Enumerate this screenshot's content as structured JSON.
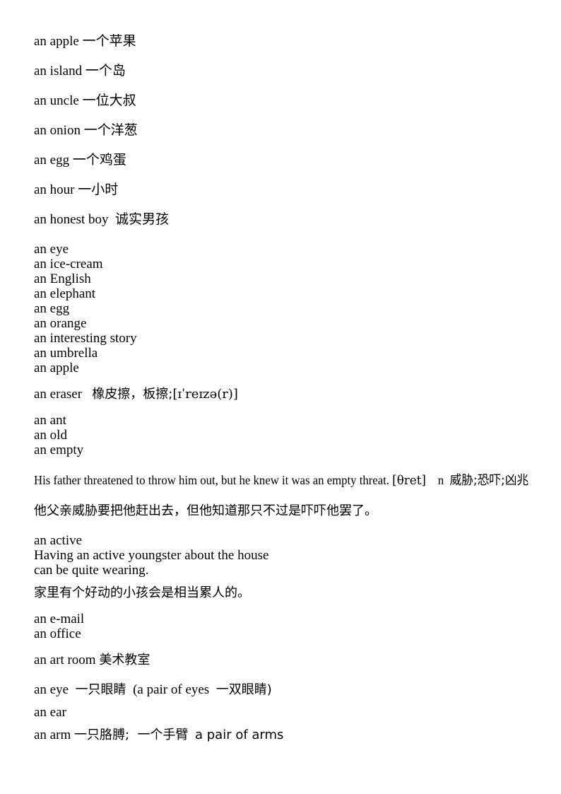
{
  "document": {
    "type": "vocabulary-worksheet",
    "language": "English-Chinese",
    "topic": "Indefinite article 'an' usage examples"
  },
  "blocks": {
    "spaced_entries": [
      {
        "en": "an apple",
        "zh": "一个苹果"
      },
      {
        "en": "an island",
        "zh": "一个岛"
      },
      {
        "en": "an uncle",
        "zh": "一位大叔"
      },
      {
        "en": "an onion",
        "zh": "一个洋葱"
      },
      {
        "en": "an egg",
        "zh": "一个鸡蛋"
      },
      {
        "en": "an hour",
        "zh": "一小时"
      },
      {
        "en": "an honest boy",
        "zh": "诚实男孩"
      }
    ],
    "tight_list_1": [
      "an eye",
      "an ice-cream",
      "an English",
      "an elephant",
      "an egg",
      "an orange",
      "an interesting story",
      "an umbrella",
      "an apple"
    ],
    "eraser": {
      "en": "an eraser",
      "zh": "橡皮擦，板擦;",
      "ipa": "[ɪˈreɪzə(r)]"
    },
    "tight_list_2": [
      "an ant",
      "an old",
      "an empty"
    ],
    "threat": {
      "sentence": "His father threatened to throw him out, but he knew it was an empty threat.",
      "ipa": "[θret]",
      "pos": "n",
      "gloss_line1": "威胁;恐",
      "gloss_line2": "吓;凶兆",
      "translation": "他父亲威胁要把他赶出去，但他知道那只不过是吓吓他罢了。"
    },
    "active": {
      "headword": "an active",
      "sentence_line1": "Having an active youngster about the house",
      "sentence_line2": "can be quite wearing.",
      "translation": "家里有个好动的小孩会是相当累人的。"
    },
    "tight_list_3": [
      "an e-mail",
      "an office"
    ],
    "art_room": {
      "en": "an art room",
      "zh": "美术教室"
    },
    "eye": {
      "en": "an eye",
      "zh": "一只眼睛",
      "paren_en": "(a pair of eyes",
      "paren_zh": "一双眼睛)"
    },
    "ear": {
      "en": "an ear"
    },
    "arm": {
      "en": "an arm",
      "zh": "一只胳膊;  一个手臂",
      "plural_en": "a pair of arms"
    }
  }
}
